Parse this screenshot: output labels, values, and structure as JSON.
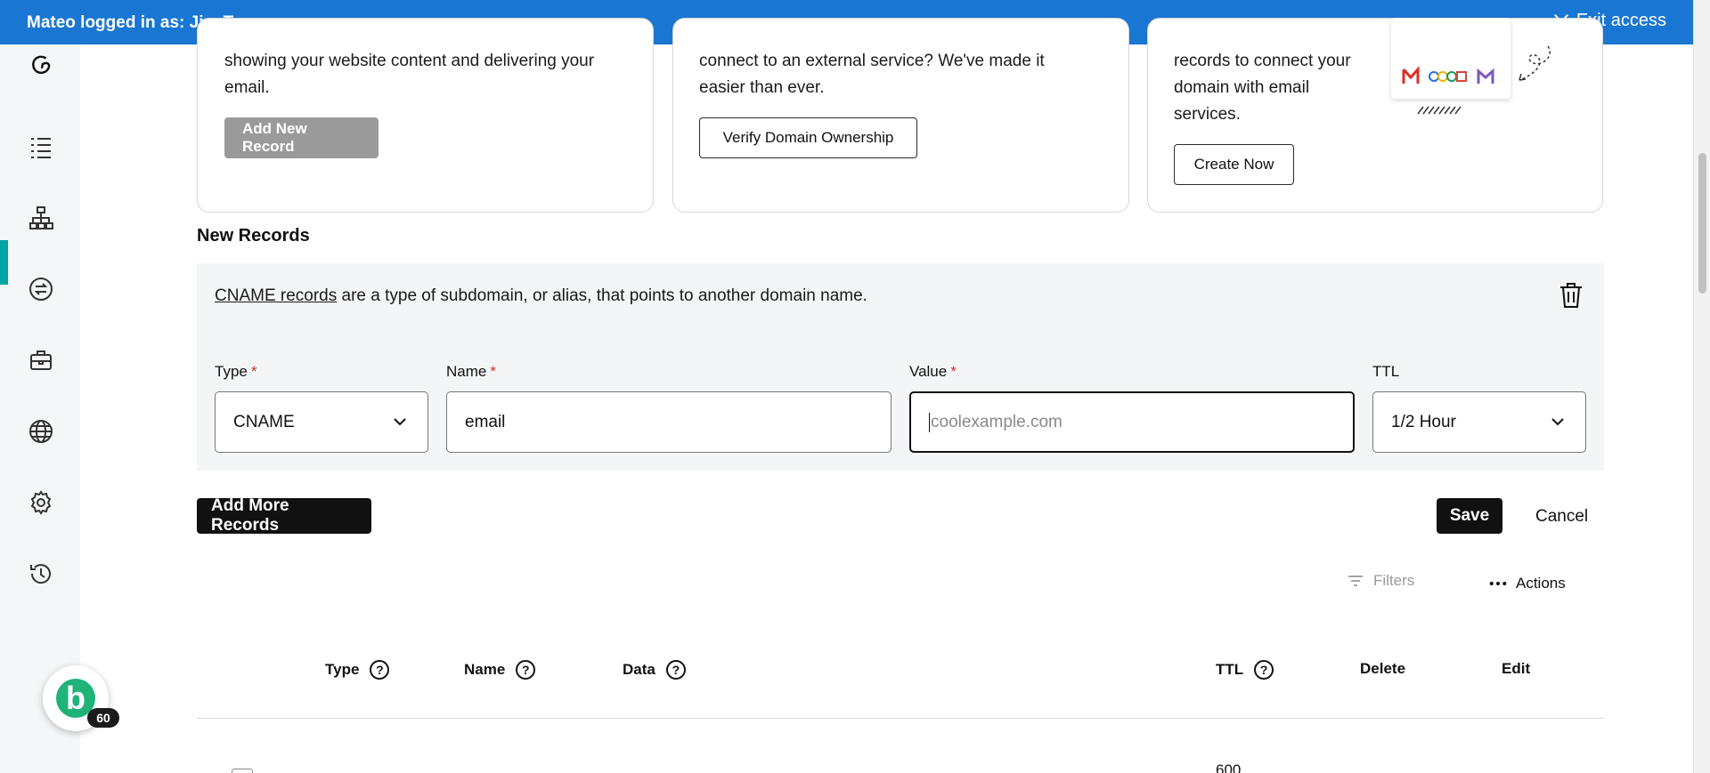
{
  "banner": {
    "text": "Mateo logged in as: Jim Turner",
    "exit_label": "Exit access"
  },
  "sidebar": {
    "icons": [
      "godaddy-logo-icon",
      "list-icon",
      "dns-tree-icon",
      "transfer-icon",
      "briefcase-icon",
      "globe-icon",
      "gear-icon",
      "history-icon"
    ],
    "active_index": 2,
    "avatar_letter": "b",
    "badge_count": "60"
  },
  "cards": [
    {
      "text_lines": [
        "showing your website content and delivering your",
        "email."
      ],
      "button_label": "Add New Record",
      "button_state": "disabled"
    },
    {
      "text_lines": [
        "connect to an external service? We've made it",
        "easier than ever."
      ],
      "button_label": "Verify Domain Ownership"
    },
    {
      "text_lines": [
        "records to connect your",
        "domain with email",
        "services."
      ],
      "button_label": "Create Now"
    }
  ],
  "new_records": {
    "title": "New Records",
    "info_link": "CNAME records",
    "info_text": " are a type of subdomain, or alias, that points to another domain name.",
    "fields": {
      "type": {
        "label": "Type",
        "value": "CNAME"
      },
      "name": {
        "label": "Name",
        "value": "email"
      },
      "value": {
        "label": "Value",
        "placeholder": "coolexample.com"
      },
      "ttl": {
        "label": "TTL",
        "value": "1/2 Hour"
      }
    },
    "add_more_label": "Add More Records",
    "save_label": "Save",
    "cancel_label": "Cancel"
  },
  "table": {
    "filters_label": "Filters",
    "actions_label": "Actions",
    "columns": [
      "Type",
      "Name",
      "Data",
      "TTL",
      "Delete",
      "Edit"
    ],
    "first_row_ttl": "600"
  },
  "colors": {
    "banner": "#1976d2",
    "accent": "#00a4a6",
    "avatar": "#1fb37a"
  }
}
